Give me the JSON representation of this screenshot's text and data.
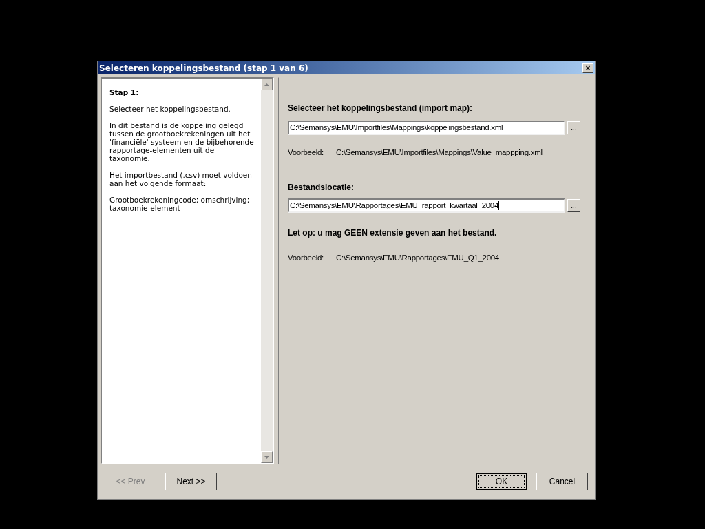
{
  "window": {
    "title": "Selecteren koppelingsbestand (stap 1 van 6)",
    "close": "×"
  },
  "help": [
    {
      "kind": "heading",
      "text": "Stap 1:"
    },
    {
      "kind": "paragraph",
      "text": "Selecteer het koppelingsbestand."
    },
    {
      "kind": "paragraph",
      "text": "In dit bestand is de koppeling gelegd tussen de grootboekrekeningen uit het 'financiële' systeem en de bijbehorende rapportage-elementen uit de taxonomie."
    },
    {
      "kind": "paragraph",
      "text": "Het importbestand (.csv) moet voldoen aan het volgende formaat:"
    },
    {
      "kind": "paragraph",
      "text": "Grootboekrekeningcode; omschrijving; taxonomie-element"
    }
  ],
  "form": [
    {
      "kind": "label",
      "text": "Selecteer het koppelingsbestand (import map):"
    },
    {
      "kind": "field",
      "value": "C:\\Semansys\\EMU\\Importfiles\\Mappings\\koppelingsbestand.xml",
      "browse": "...",
      "focused": false
    },
    {
      "kind": "example",
      "label": "Voorbeeld:",
      "text": "C:\\Semansys\\EMU\\Importfiles\\Mappings\\Value_mappping.xml"
    },
    {
      "kind": "label",
      "text": "Bestandslocatie:"
    },
    {
      "kind": "field",
      "value": "C:\\Semansys\\EMU\\Rapportages\\EMU_rapport_kwartaal_2004",
      "browse": "...",
      "focused": true
    },
    {
      "kind": "warning",
      "text": "Let op: u mag GEEN extensie geven aan het bestand."
    },
    {
      "kind": "example",
      "label": "Voorbeeld:",
      "text": "C:\\Semansys\\EMU\\Rapportages\\EMU_Q1_2004"
    }
  ],
  "buttons": [
    {
      "label": "<< Prev",
      "disabled": true,
      "default": false
    },
    {
      "label": "Next >>",
      "disabled": false,
      "default": false
    },
    {
      "label": "OK",
      "disabled": false,
      "default": true
    },
    {
      "label": "Cancel",
      "disabled": false,
      "default": false
    }
  ]
}
